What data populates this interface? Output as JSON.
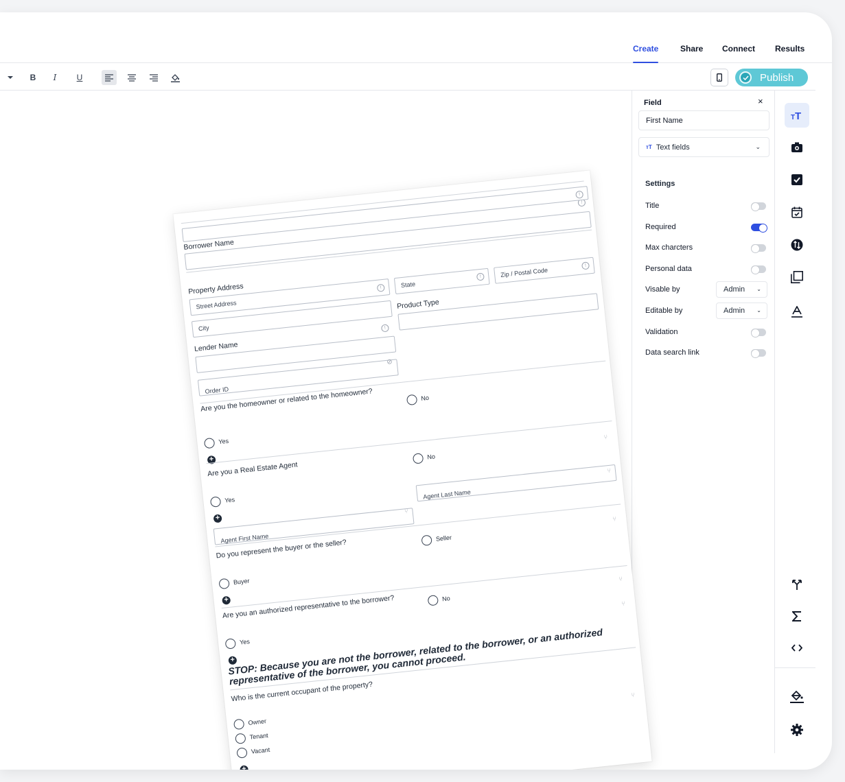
{
  "nav": {
    "tabs": [
      "Create",
      "Share",
      "Connect",
      "Results"
    ],
    "active": "Create"
  },
  "toolbar": {
    "bold": "B",
    "italic": "I",
    "underline": "U",
    "publish_label": "Publish"
  },
  "panel": {
    "header": "Field",
    "close": "×",
    "field_name": "First Name",
    "field_type": "Text fields",
    "settings_title": "Settings",
    "rows": [
      {
        "label": "Title",
        "toggle": false
      },
      {
        "label": "Required",
        "toggle": true
      },
      {
        "label": "Max charcters",
        "toggle": false
      },
      {
        "label": "Personal data",
        "toggle": false
      },
      {
        "label": "Visable by",
        "select": "Admin"
      },
      {
        "label": "Editable by",
        "select": "Admin"
      },
      {
        "label": "Validation",
        "toggle": false
      },
      {
        "label": "Data search link",
        "toggle": false
      }
    ]
  },
  "form": {
    "borrower_name": "Borrower Name",
    "property_address": "Property Address",
    "street_address": "Street Address",
    "state": "State",
    "zip": "Zip / Postal Code",
    "city": "City",
    "product_type": "Product Type",
    "lender_name": "Lender Name",
    "order_id": "Order ID",
    "q_homeowner": "Are you the homeowner or related to the homeowner?",
    "q_agent": "Are you a Real Estate Agent",
    "agent_first": "Agent First Name",
    "agent_last": "Agent Last Name",
    "q_represent": "Do you represent the buyer or the seller?",
    "q_authorized": "Are you an authorized representative to the borrower?",
    "stop_line1": "STOP: Because you are not the borrower, related to the borrower, or an authorized",
    "stop_line2": "representative of the borrower, you cannot proceed.",
    "q_occupant": "Who is the current occupant of the property?",
    "opt_yes": "Yes",
    "opt_no": "No",
    "opt_buyer": "Buyer",
    "opt_seller": "Seller",
    "opt_owner": "Owner",
    "opt_tenant": "Tenant",
    "opt_vacant": "Vacant"
  }
}
